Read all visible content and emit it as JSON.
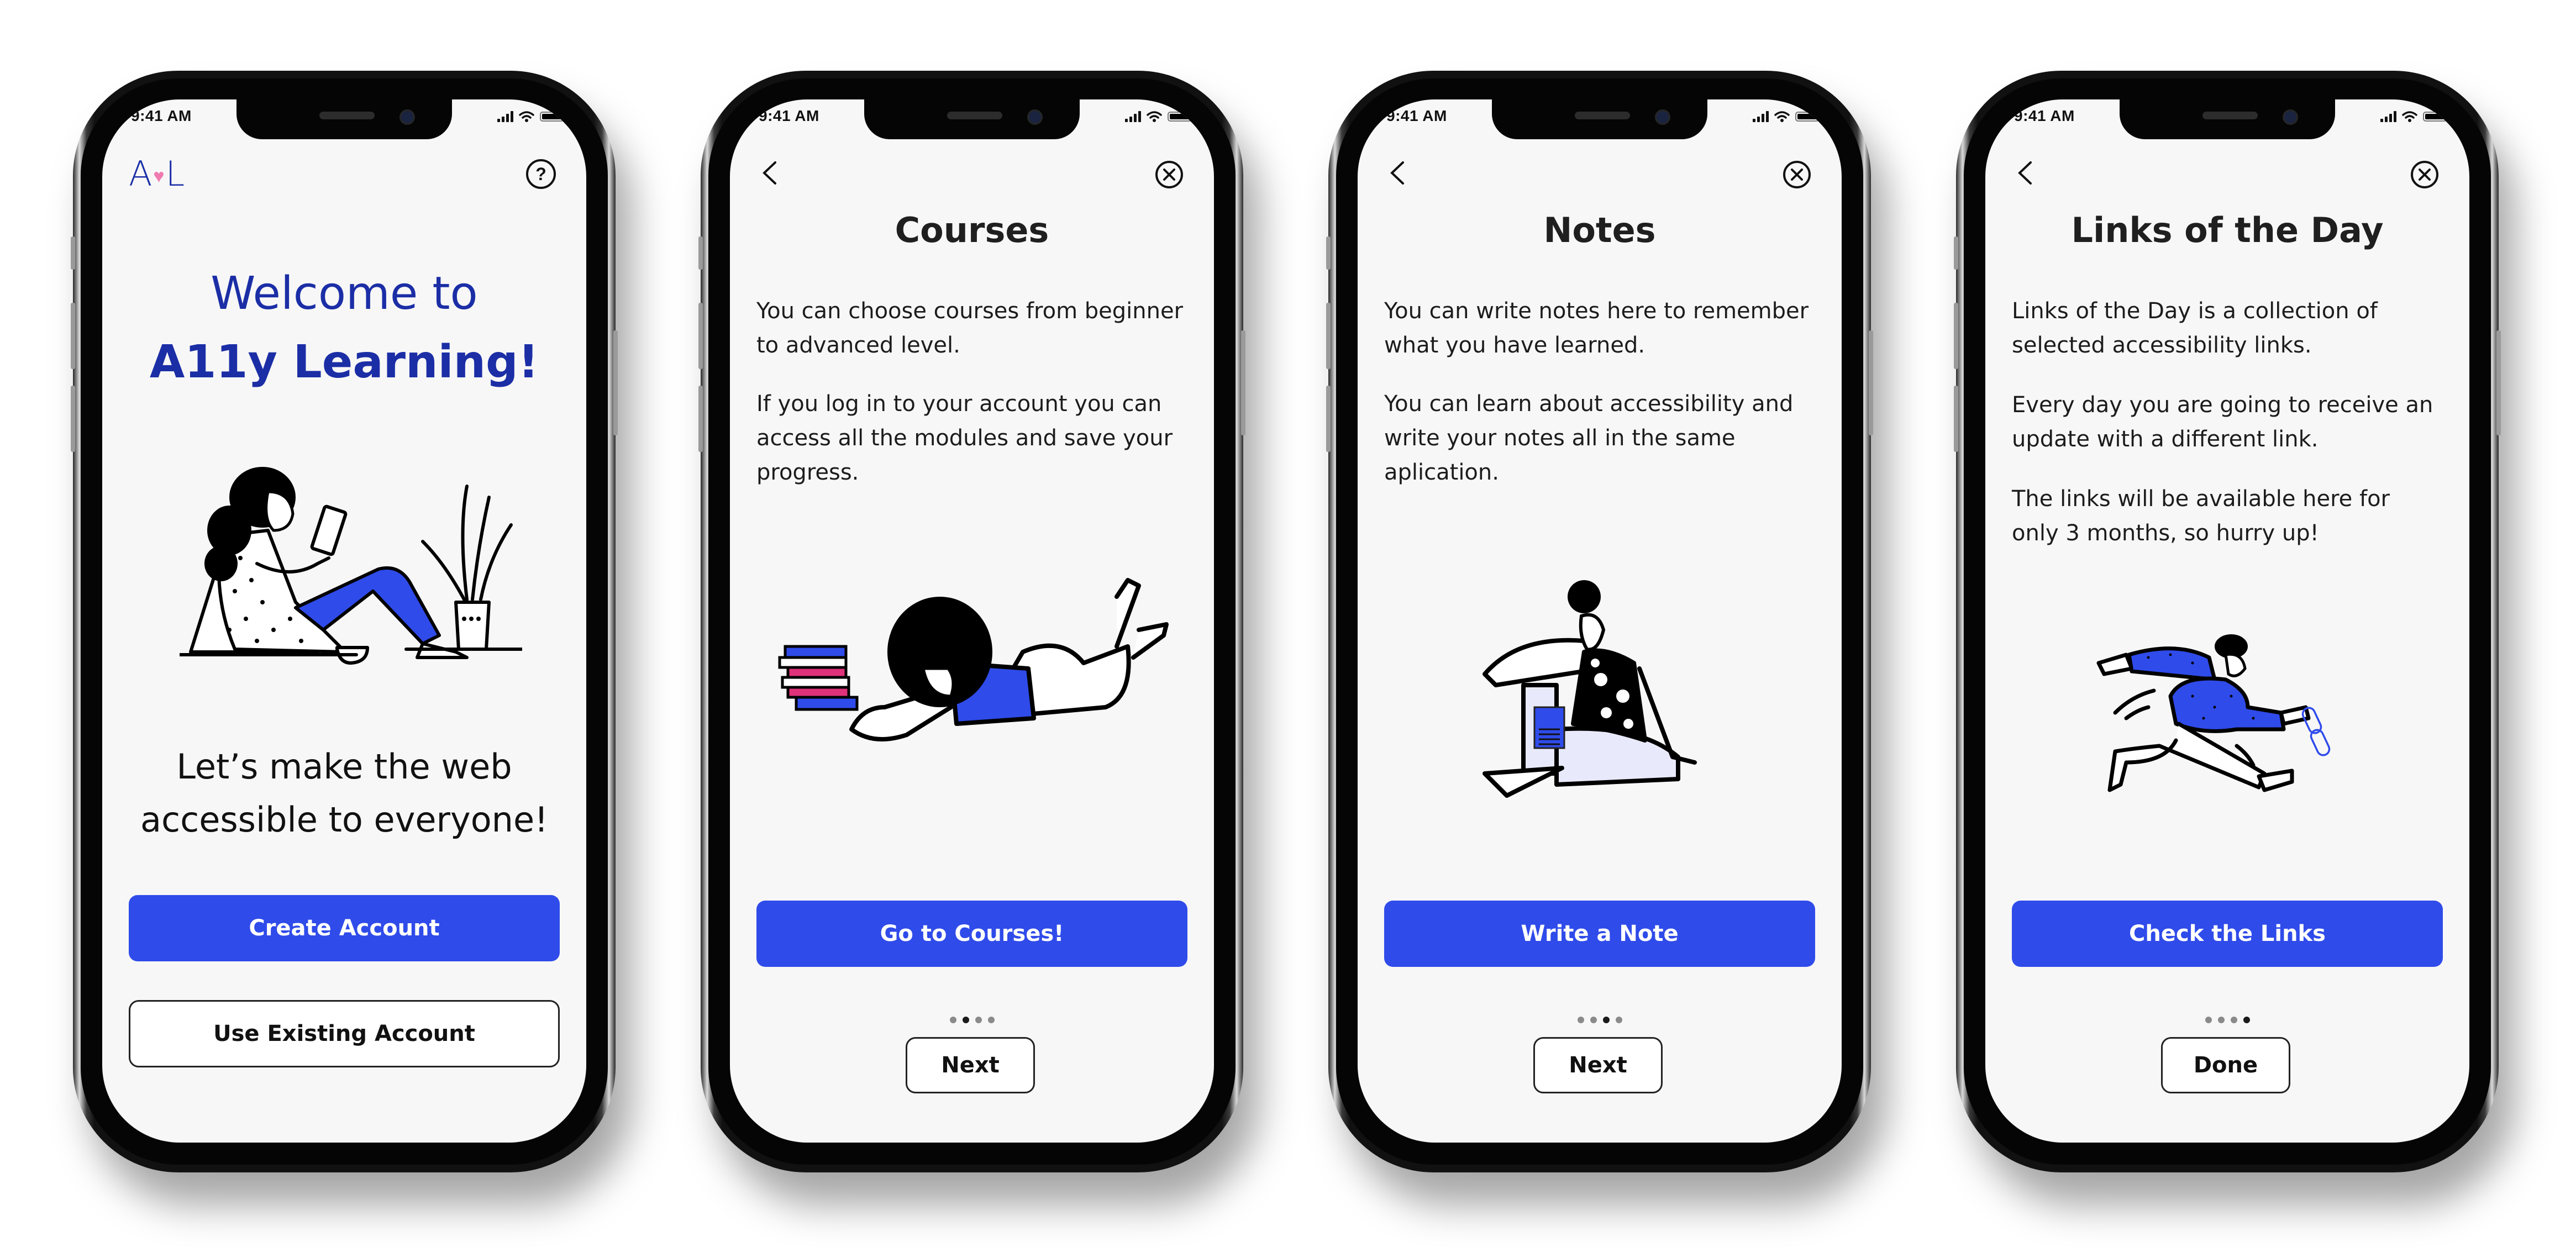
{
  "status_bar": {
    "time": "9:41 AM"
  },
  "colors": {
    "primary": "#2f4bea",
    "brand_text": "#1b2ea6",
    "logo_heart": "#f07ab0",
    "text": "#1c1c1c",
    "screen_bg": "#f7f7f7"
  },
  "screens": [
    {
      "id": "welcome",
      "logo": {
        "left": "A",
        "heart": "♥",
        "right": "L"
      },
      "help_icon": "?",
      "title_line1": "Welcome to",
      "title_line2": "A11y Learning!",
      "illustration": "woman-reading-with-plant",
      "tagline_line1": "Let’s make the web",
      "tagline_line2": "accessible to everyone!",
      "primary_button": "Create Account",
      "secondary_button": "Use Existing Account"
    },
    {
      "id": "courses",
      "title": "Courses",
      "paragraphs": [
        "You can choose courses from beginner to advanced level.",
        "If you log in to your account you can access all the modules and save your progress."
      ],
      "illustration": "person-lying-with-phone-and-books",
      "primary_button": "Go to Courses!",
      "page_indicator": {
        "current": 2,
        "total": 4
      },
      "secondary_button": "Next"
    },
    {
      "id": "notes",
      "title": "Notes",
      "paragraphs": [
        "You can write notes here to remember what you have learned.",
        "You can learn about accessibility and write your notes all in the same aplication."
      ],
      "illustration": "woman-sitting-with-note",
      "primary_button": "Write a Note",
      "page_indicator": {
        "current": 3,
        "total": 4
      },
      "secondary_button": "Next"
    },
    {
      "id": "links",
      "title": "Links of the Day",
      "paragraphs": [
        "Links of the Day is a collection of selected accessibility links.",
        "Every day you are going to receive an update with a different link.",
        "The links will be available here for only 3 months, so hurry up!"
      ],
      "illustration": "person-running-with-chain-link",
      "primary_button": "Check the Links",
      "page_indicator": {
        "current": 4,
        "total": 4
      },
      "secondary_button": "Done"
    }
  ]
}
